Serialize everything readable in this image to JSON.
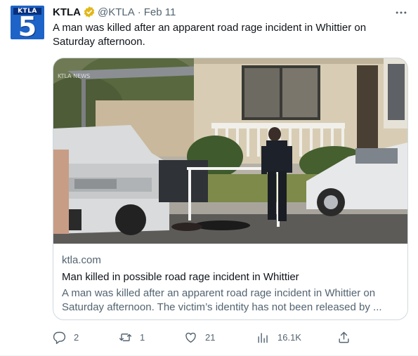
{
  "account": {
    "display_name": "KTLA",
    "handle": "@KTLA",
    "separator": "·",
    "date": "Feb 11",
    "avatar_logo_top": "KTLA",
    "avatar_logo_num": "5"
  },
  "tweet": {
    "text": "A man was killed after an apparent road rage incident in Whittier on Saturday afternoon."
  },
  "card": {
    "image_watermark": "KTLA NEWS",
    "domain": "ktla.com",
    "title": "Man killed in possible road rage incident in Whittier",
    "description": "A man was killed after an apparent road rage incident in Whittier on Saturday afternoon. The victim’s identity has not been released by ..."
  },
  "actions": {
    "replies": "2",
    "retweets": "1",
    "likes": "21",
    "views": "16.1K"
  },
  "icons": {
    "verified": "verified-badge-icon",
    "more": "more-icon",
    "reply": "reply-icon",
    "retweet": "retweet-icon",
    "like": "like-icon",
    "views": "views-icon",
    "share": "share-icon"
  },
  "colors": {
    "verified_gold": "#e2b719",
    "text_primary": "#0f1419",
    "text_secondary": "#536471",
    "border": "#cfd9de",
    "avatar_blue": "#1d63c8"
  }
}
